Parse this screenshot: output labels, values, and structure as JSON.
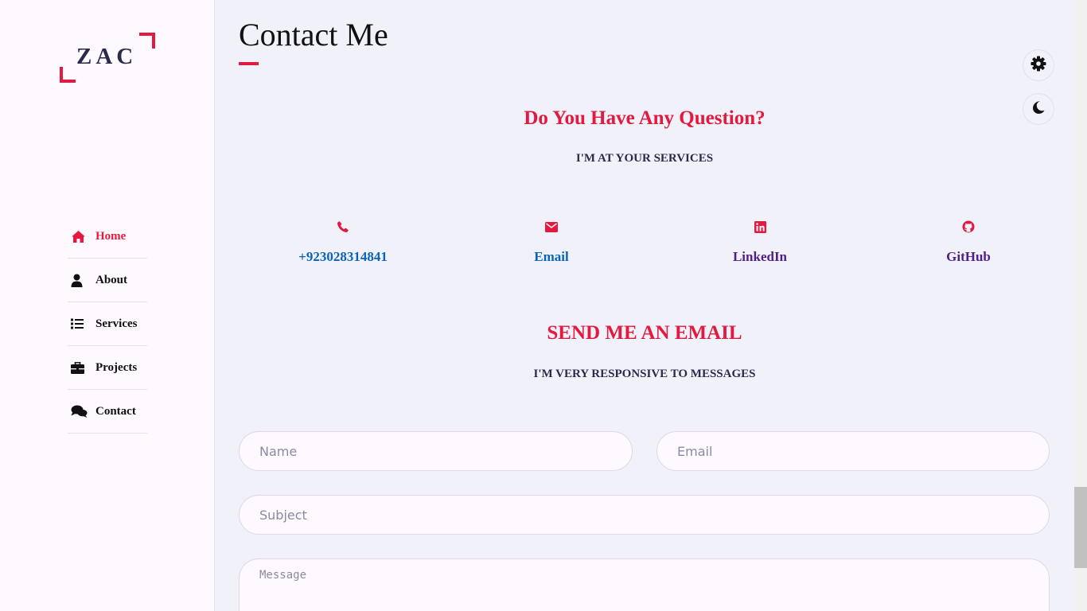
{
  "logo": {
    "text": "ZAC"
  },
  "nav": {
    "items": [
      {
        "label": "Home",
        "icon": "home-icon",
        "active": true
      },
      {
        "label": "About",
        "icon": "user-icon"
      },
      {
        "label": "Services",
        "icon": "list-icon"
      },
      {
        "label": "Projects",
        "icon": "briefcase-icon"
      },
      {
        "label": "Contact",
        "icon": "comments-icon"
      }
    ]
  },
  "main": {
    "title": "Contact Me",
    "question_heading": "Do You Have Any Question?",
    "question_sub": "I'M AT YOUR SERVICES",
    "contacts": [
      {
        "label": "+923028314841",
        "icon": "phone-icon"
      },
      {
        "label": "Email",
        "icon": "envelope-icon"
      },
      {
        "label": "LinkedIn",
        "icon": "linkedin-icon"
      },
      {
        "label": "GitHub",
        "icon": "github-icon"
      }
    ],
    "send_heading": "SEND ME AN EMAIL",
    "send_sub": "I'M VERY RESPONSIVE TO MESSAGES"
  },
  "form": {
    "name_placeholder": "Name",
    "email_placeholder": "Email",
    "subject_placeholder": "Subject",
    "message_placeholder": "Message"
  },
  "controls": {
    "settings_icon": "gear-icon",
    "theme_icon": "moon-icon"
  },
  "colors": {
    "accent": "#e3193f",
    "link": "#0b63b8",
    "visited_link": "#4e1f86",
    "text_dark": "#2a2a4a",
    "background": "#f1f1fa",
    "sidebar_bg": "#fdf9ff"
  }
}
